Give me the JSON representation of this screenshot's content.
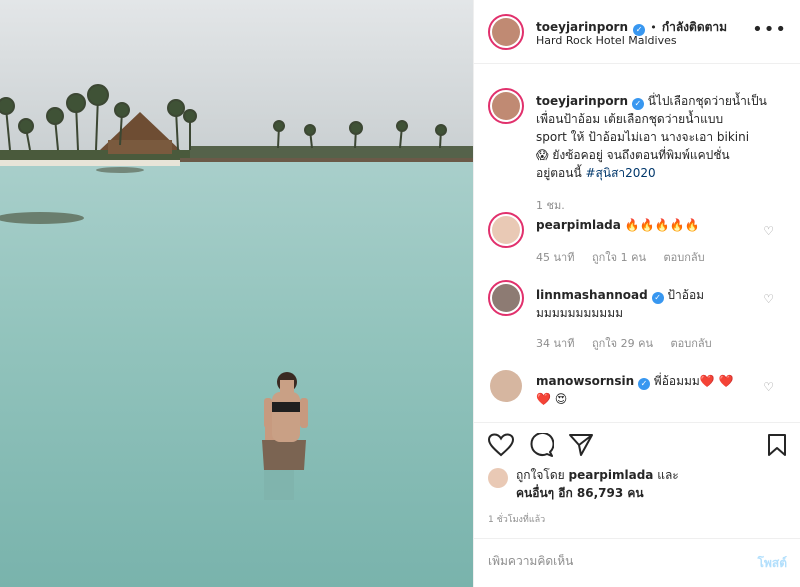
{
  "header": {
    "username": "toeyjarinporn",
    "separator": "•",
    "follow_status": "กำลังติดตาม",
    "location": "Hard Rock Hotel Maldives",
    "more_icon": "more-horizontal-icon"
  },
  "caption": {
    "username": "toeyjarinporn",
    "text_line1": "นี่ไปเลือกชุดว่ายน้ำเป็น",
    "text_line2": "เพื่อนป้าอ้อม เต้ยเลือกชุดว่ายน้ำแบบ",
    "text_line3": "sport ให้ ป้าอ้อมไม่เอา นางจะเอา bikini",
    "emoji": "😱",
    "text_line4": "ยังซ้อคอยู่ จนถึงตอนที่พิมพ์แคปชั่น",
    "text_line5": "อยู่ตอนนี้",
    "hashtag": "#สุนิสา2020",
    "time": "1 ชม."
  },
  "comments": [
    {
      "username": "pearpimlada",
      "text": "🔥🔥🔥🔥🔥",
      "time": "45 นาที",
      "likes": "ถูกใจ 1 คน",
      "reply": "ตอบกลับ"
    },
    {
      "username": "linnmashannoad",
      "verified": true,
      "text_line1": "ป้าอ้อม",
      "text_line2": "มมมมมมมมมมม",
      "time": "34 นาที",
      "likes": "ถูกใจ 29 คน",
      "reply": "ตอบกลับ"
    },
    {
      "username": "manowsornsin",
      "verified": true,
      "text_line1": "พี่อ้อมมม❤️ ❤️",
      "text_line2": "❤️ 😍"
    }
  ],
  "likes": {
    "prefix": "ถูกใจโดย",
    "first_user": "pearpimlada",
    "and": "และ",
    "others_label": "คนอื่นๆ อีก 86,793 คน"
  },
  "timestamp": "1 ชั่วโมงที่แล้ว",
  "comment_box": {
    "placeholder": "เพิ่มความคิดเห็น",
    "post_label": "โพสต์"
  },
  "colors": {
    "verified": "#3897f0",
    "story_ring": "#e1306c",
    "sea": "#8fc4bd",
    "sky": "#d8dde0"
  }
}
